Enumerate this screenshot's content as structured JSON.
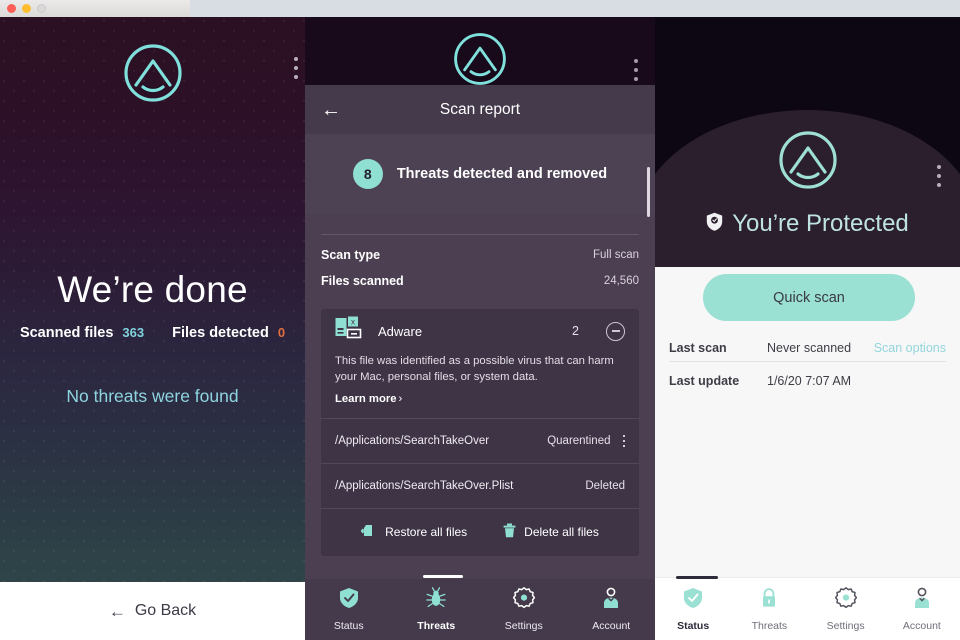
{
  "window": {
    "traffic_lights": [
      "close",
      "minimize",
      "zoom"
    ]
  },
  "left_panel": {
    "logo": "app-logo",
    "menu_icon": "overflow-menu-icon",
    "headline": "We’re done",
    "stats": [
      {
        "label": "Scanned files",
        "value": "363",
        "color": "#7fd3dd"
      },
      {
        "label": "Files detected",
        "value": "0",
        "color": "#e2703f"
      }
    ],
    "subline": "No threats were found",
    "go_back": {
      "arrow": "←",
      "label": "Go Back"
    }
  },
  "mid_panel": {
    "logo": "app-logo",
    "menu_icon": "overflow-menu-icon",
    "back_arrow": "←",
    "title": "Scan report",
    "threat_summary": {
      "count": "8",
      "text": "Threats detected and removed"
    },
    "info_rows": [
      {
        "key": "Scan type",
        "value": "Full scan"
      },
      {
        "key": "Files scanned",
        "value": "24,560"
      }
    ],
    "threat_card": {
      "icon": "file-virus-icon",
      "name": "Adware",
      "count": "2",
      "collapse_icon": "circle-minus-icon",
      "description": "This file was identified as a possible virus that can harm your Mac, personal files, or system data.",
      "learn_more": "Learn more",
      "learn_more_chevron": "›",
      "files": [
        {
          "path": "/Applications/SearchTakeOver",
          "state": "Quarentined",
          "menu": "kebab-menu-icon"
        },
        {
          "path": "/Applications/SearchTakeOver.Plist",
          "state": "Deleted",
          "menu": ""
        }
      ],
      "actions": [
        {
          "icon": "restore-file-icon",
          "label": "Restore all files"
        },
        {
          "icon": "trash-icon",
          "label": "Delete all files"
        }
      ]
    },
    "nav": [
      {
        "icon": "shield-check-icon",
        "label": "Status",
        "active": false
      },
      {
        "icon": "bug-icon",
        "label": "Threats",
        "active": true
      },
      {
        "icon": "gear-icon",
        "label": "Settings",
        "active": false
      },
      {
        "icon": "account-icon",
        "label": "Account",
        "active": false
      }
    ]
  },
  "right_panel": {
    "logo": "app-logo",
    "menu_icon": "overflow-menu-icon",
    "status_icon": "shield-check-icon",
    "status_text": "You’re Protected",
    "quick_scan": "Quick scan",
    "rows": [
      {
        "key": "Last scan",
        "value": "Never scanned",
        "link": "Scan options"
      },
      {
        "key": "Last update",
        "value": "1/6/20 7:07 AM",
        "link": ""
      }
    ],
    "nav": [
      {
        "icon": "shield-check-icon",
        "label": "Status",
        "active": true
      },
      {
        "icon": "lock-icon",
        "label": "Threats",
        "active": false
      },
      {
        "icon": "gear-icon",
        "label": "Settings",
        "active": false
      },
      {
        "icon": "account-icon",
        "label": "Account",
        "active": false
      }
    ]
  },
  "colors": {
    "accent_teal": "#8fe0d2",
    "accent_cyan": "#7fd3dd",
    "warning_orange": "#e2703f",
    "mid_bg": "#4b3f51",
    "right_bg": "#f7f7f8"
  }
}
